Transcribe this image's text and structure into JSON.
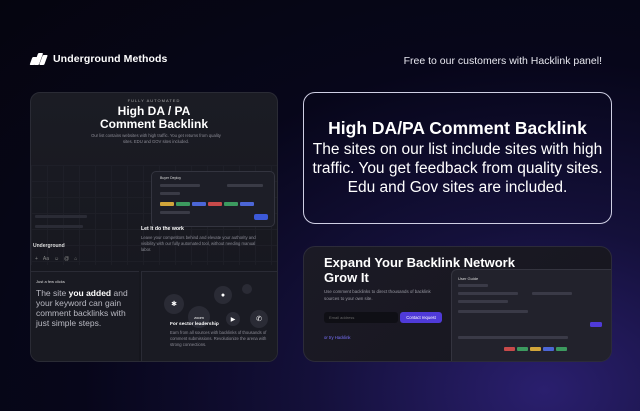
{
  "brand": {
    "name": "Underground Methods",
    "tagline": "Free to our customers with Hacklink panel!"
  },
  "left_card": {
    "eyebrow": "FULLY AUTOMATED",
    "title": "High DA / PA\nComment Backlink",
    "description": "Our list contains websites with high traffic. You get returns from quality sites. EDU and GOV sites included.",
    "mini_label": "Underground",
    "panel_heading": "Buyer Deploy",
    "link_title": "Let It do the work",
    "link_description": "Leave your competitors behind and elevate your authority and visibility with our fully automated tool, without needing manual labor.",
    "steps_eyebrow": "Just a few clicks",
    "steps_text_pre": "The site ",
    "steps_text_hl": "you added",
    "steps_text_post": " and your keyword can gain comment backlinks with just simple steps.",
    "sector_title": "For sector leadership",
    "sector_description": "Earn from all sources with backlinks of thousands of comment submissions. Revolutionize the arena with strong connections.",
    "zoom_label": "zoom"
  },
  "right_top_card": {
    "title": "High DA/PA Comment Backlink",
    "description": "The sites on our list include sites with high traffic. You get feedback from quality sites. Edu and Gov sites are included."
  },
  "right_bottom_card": {
    "title": "Expand Your Backlink Network Grow It",
    "description": "Use comment backlinks to direct thousands of backlink sources to your own site.",
    "input_placeholder": "Email address",
    "button_label": "Contact request",
    "link_label": "or try Hacklink",
    "panel_heading": "User Guide"
  },
  "colors": {
    "accent": "#4f3ad8",
    "blue": "#3c59d9",
    "card_border": "#cfcfe4"
  }
}
